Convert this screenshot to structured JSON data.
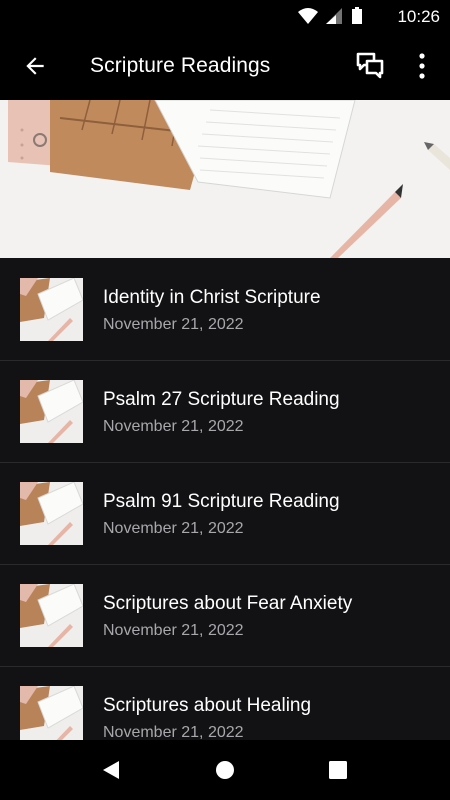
{
  "status": {
    "time": "10:26"
  },
  "appbar": {
    "title": "Scripture Readings"
  },
  "icons": {
    "back": "arrow-back-icon",
    "chat": "chat-bubbles-icon",
    "more": "more-vertical-icon",
    "wifi": "wifi-icon",
    "signal": "cell-signal-icon",
    "battery": "battery-icon"
  },
  "items": [
    {
      "title": "Identity in Christ Scripture",
      "date": "November 21, 2022"
    },
    {
      "title": "Psalm 27 Scripture Reading",
      "date": "November 21, 2022"
    },
    {
      "title": "Psalm 91 Scripture Reading",
      "date": "November 21, 2022"
    },
    {
      "title": "Scriptures about Fear Anxiety",
      "date": "November 21, 2022"
    },
    {
      "title": "Scriptures about Healing",
      "date": "November 21, 2022"
    }
  ]
}
